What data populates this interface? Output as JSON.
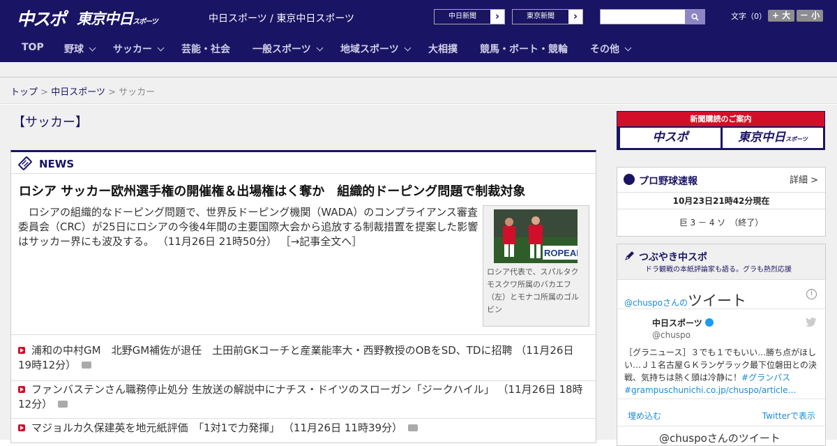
{
  "header": {
    "logo_main": "中スポ",
    "logo_tokyo": "東京中日",
    "logo_tokyo_small": "スポーツ",
    "site_title": "中日スポーツ / 東京中日スポーツ",
    "site_links": [
      "中日新聞",
      "東京新聞"
    ],
    "search_placeholder": "",
    "font_size_label": "文字（0）",
    "font_larger": "+ 大",
    "font_smaller": "－ 小"
  },
  "nav": {
    "items": [
      {
        "label": "TOP",
        "has_dropdown": false
      },
      {
        "label": "野球",
        "has_dropdown": true
      },
      {
        "label": "サッカー",
        "has_dropdown": true
      },
      {
        "label": "芸能・社会",
        "has_dropdown": false
      },
      {
        "label": "一般スポーツ",
        "has_dropdown": true
      },
      {
        "label": "地域スポーツ",
        "has_dropdown": true
      },
      {
        "label": "大相撲",
        "has_dropdown": false
      },
      {
        "label": "競馬・ボート・競輪",
        "has_dropdown": false
      },
      {
        "label": "その他",
        "has_dropdown": true
      }
    ]
  },
  "breadcrumb": {
    "items": [
      "トップ",
      "中日スポーツ",
      "サッカー"
    ],
    "separator": ">"
  },
  "page_title": "【サッカー】",
  "news": {
    "section_label": "NEWS",
    "headline": "ロシア サッカー欧州選手権の開催権＆出場権はく奪か　組織的ドーピング問題で制裁対象",
    "lead": "ロシアの組織的なドーピング問題で、世界反ドーピング機関（WADA）のコンプライアンス審査委員会（CRC）が25日にロシアの今後4年間の主要国際大会から追放する制裁措置を提案した影響はサッカー界にも波及する。",
    "lead_time": "（11月26日 21時50分）",
    "lead_more": "［→記事全文へ］",
    "photo_banner_text": "ROPEAN",
    "photo_caption": "ロシア代表で、スパルタクモスクワ所属のバカエフ（左）とモナコ所属のゴルビン",
    "items": [
      {
        "title": "浦和の中村GM　北野GM補佐が退任　土田前GKコーチと産業能率大・西野教授のOBをSD、TDに招聘",
        "time": "（11月26日 19時12分）"
      },
      {
        "title": "ファンバステンさん職務停止処分 生放送の解説中にナチス・ドイツのスローガン「ジークハイル」",
        "time": "（11月26日 18時12分）"
      },
      {
        "title": "マジョルカ久保建英を地元紙評価　「1対1で力発揮」",
        "time": "（11月26日 11時39分）"
      }
    ]
  },
  "sidebar": {
    "subscribe": {
      "banner": "新聞購読のご案内",
      "left_logo": "中スポ",
      "right_logo": "東京中日",
      "right_logo_small": "スポーツ"
    },
    "pro_baseball": {
      "title": "プロ野球速報",
      "detail_link": "詳細 >",
      "as_of": "10月23日21時42分現在",
      "score": "巨 3 － 4 ソ　（終了）"
    },
    "twitter": {
      "title": "つぶやき中スポ",
      "subtitle": "ドラ観戦の本紙評論家も語る。グラも熱烈応援",
      "handle": "@chuspo",
      "handle_suffix": "さんの",
      "heading": "ツイート",
      "info_icon": "i",
      "account_name": "中日スポーツ",
      "account_user": "@chuspo",
      "tweet_text": "［グラニュース］３でも１でもいい…勝ち点がほしい…Ｊ１名古屋ＧＫランゲラック最下位磐田との決戦、気持ちは熱く頭は冷静に！",
      "tweet_hashtag": "#グランパス",
      "tweet_link": "#grampuschunichi.co.jp/chuspo/article…",
      "embed_label": "埋め込む",
      "view_label": "Twitterで表示",
      "bottom_label": "@chuspoさんのツイート"
    }
  },
  "colors": {
    "brand_navy": "#1a1464",
    "accent_red": "#d0102a",
    "link_blue": "#1a8ad8",
    "search_button": "#8e86c4"
  },
  "icons": {
    "search": "search-icon",
    "news": "news-tag-icon",
    "bullet": "play-bullet-icon",
    "camera": "camera-icon",
    "baseball": "baseball-icon",
    "pen": "pen-icon",
    "info": "info-icon",
    "verified": "verified-badge-icon",
    "bird": "twitter-bird-icon"
  }
}
